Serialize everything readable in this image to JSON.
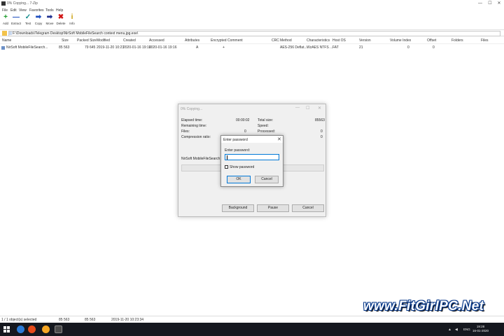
{
  "window": {
    "title": "0% Copying... 7-Zip",
    "controls": [
      "—",
      "☐",
      "✕"
    ]
  },
  "menu": [
    "File",
    "Edit",
    "View",
    "Favorites",
    "Tools",
    "Help"
  ],
  "toolbar": [
    {
      "label": "Add",
      "icon": "plus-icon",
      "glyph": "+",
      "color": "#1a9b2a"
    },
    {
      "label": "Extract",
      "icon": "minus-icon",
      "glyph": "—",
      "color": "#1f4fbf"
    },
    {
      "label": "Test",
      "icon": "check-icon",
      "glyph": "✓",
      "color": "#0f8a8a"
    },
    {
      "label": "Copy",
      "icon": "copy-arrow-icon",
      "glyph": "➡",
      "color": "#1f4fbf"
    },
    {
      "label": "Move",
      "icon": "move-arrow-icon",
      "glyph": "➡",
      "color": "#1f2f8f"
    },
    {
      "label": "Delete",
      "icon": "delete-x-icon",
      "glyph": "✖",
      "color": "#d01515"
    },
    {
      "label": "Info",
      "icon": "info-icon",
      "glyph": "i",
      "color": "#c89a00"
    }
  ],
  "address": {
    "path": "F:\\Downloads\\Telegram Desktop\\NirSoft MobileFileSearch context menu.jpg.exe\\"
  },
  "columns": [
    "Name",
    "Size",
    "Packed Size",
    "Modified",
    "Created",
    "Accessed",
    "Attributes",
    "Encrypted",
    "Comment",
    "CRC",
    "Method",
    "Characteristics",
    "Host OS",
    "Version",
    "Volume Index",
    "Offset",
    "Folders",
    "Files"
  ],
  "rows": [
    {
      "name": "NirSoft MobileFileSearch...",
      "size": "85 563",
      "packed": "79 645",
      "modified": "2019-11-20 10:23",
      "created": "2020-01-16 19:16",
      "accessed": "2020-01-16 19:16",
      "attributes": "A",
      "encrypted": "+",
      "method": "AES-256 Deflat...",
      "characteristics": "WzAES NTFS ...",
      "host_os": "FAT",
      "version": "21",
      "volume_index": "0",
      "offset": "0"
    }
  ],
  "copy_dialog": {
    "title": "0% Copying...",
    "elapsed_label": "Elapsed time:",
    "elapsed_value": "00:00:02",
    "remaining_label": "Remaining time:",
    "files_label": "Files:",
    "files_value": "0",
    "ratio_label": "Compression ratio:",
    "total_label": "Total size:",
    "total_value": "85563",
    "speed_label": "Speed:",
    "processed_label": "Processed:",
    "processed_value": "0",
    "packed_value": "0",
    "current_file": "NirSoft MobileFileSearch context",
    "background_btn": "Background",
    "pause_btn": "Pause",
    "cancel_btn": "Cancel",
    "controls": [
      "—",
      "☐",
      "✕"
    ]
  },
  "password_dialog": {
    "title": "Enter password",
    "prompt": "Enter password:",
    "show_password": "Show password",
    "ok": "OK",
    "cancel": "Cancel"
  },
  "status": {
    "selected": "1 / 1 object(s) selected",
    "size": "85 563",
    "packed": "85 563",
    "date": "2019-11-20 10:23:34"
  },
  "watermark": "www.FitGirlPC.Net",
  "taskbar": {
    "lang": "ENG",
    "time": "19:28",
    "date": "16-01-2020"
  }
}
